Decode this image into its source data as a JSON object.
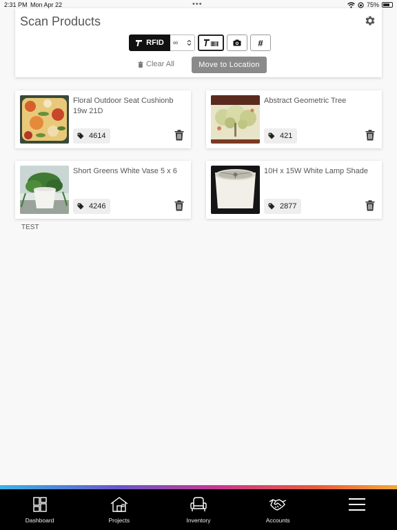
{
  "status_bar": {
    "time": "2:31 PM",
    "date": "Mon Apr 22",
    "battery_text": "75%",
    "battery_level": 0.75
  },
  "header": {
    "title": "Scan Products",
    "rfid_label": "RFID",
    "qty_value": "∞",
    "clear_all_label": "Clear All",
    "move_label": "Move to Location",
    "hash_label": "#"
  },
  "products": [
    {
      "name": "Floral Outdoor Seat Cushionb 19w 21D",
      "tag": "4614",
      "thumb": "floral-cushion"
    },
    {
      "name": "Abstract Geometric Tree",
      "tag": "421",
      "thumb": "geometric-tree-art"
    },
    {
      "name": "Short Greens White Vase 5 x 6",
      "tag": "4246",
      "thumb": "plant-vase"
    },
    {
      "name": "10H x 15W White Lamp Shade",
      "tag": "2877",
      "thumb": "lamp-shade"
    }
  ],
  "footer_note": "TEST",
  "nav": [
    {
      "label": "Dashboard",
      "icon": "dashboard-icon"
    },
    {
      "label": "Projects",
      "icon": "house-icon"
    },
    {
      "label": "Inventory",
      "icon": "chair-icon"
    },
    {
      "label": "Accounts",
      "icon": "handshake-icon"
    },
    {
      "label": "",
      "icon": "menu-icon"
    }
  ],
  "colors": {
    "primary_dark": "#111111",
    "move_button": "#8a8a8a",
    "nav_background": "#000000",
    "page_background": "#f8f8f8"
  }
}
